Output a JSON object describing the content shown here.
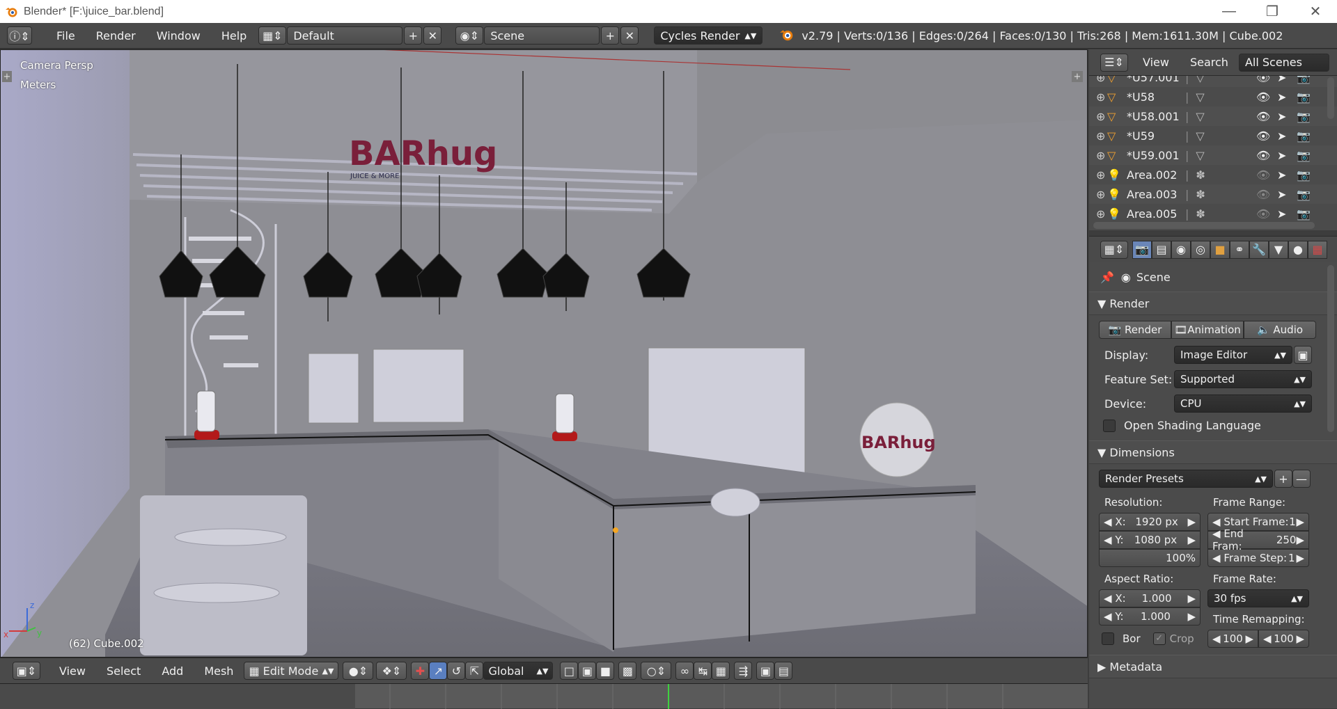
{
  "window": {
    "title": "Blender* [F:\\juice_bar.blend]",
    "app_icon": "blender-logo"
  },
  "infobar": {
    "menus": [
      "File",
      "Render",
      "Window",
      "Help"
    ],
    "screen_layout": "Default",
    "scene": "Scene",
    "render_engine": "Cycles Render",
    "stats": "v2.79 | Verts:0/136 | Edges:0/264 | Faces:0/130 | Tris:268 | Mem:1611.30M | Cube.002"
  },
  "viewport": {
    "view_name": "Camera Persp",
    "units": "Meters",
    "object_info": "(62) Cube.002",
    "axis_x": "x",
    "axis_y": "y",
    "axis_z": "z"
  },
  "view3d_header": {
    "menus": [
      "View",
      "Select",
      "Add",
      "Mesh"
    ],
    "mode": "Edit Mode",
    "orientation": "Global"
  },
  "outliner": {
    "menus": [
      "View",
      "Search"
    ],
    "filter": "All Scenes",
    "items": [
      {
        "name": "*U57.001",
        "type": "mesh"
      },
      {
        "name": "*U58",
        "type": "mesh"
      },
      {
        "name": "*U58.001",
        "type": "mesh"
      },
      {
        "name": "*U59",
        "type": "mesh"
      },
      {
        "name": "*U59.001",
        "type": "mesh"
      },
      {
        "name": "Area.002",
        "type": "lamp"
      },
      {
        "name": "Area.003",
        "type": "lamp"
      },
      {
        "name": "Area.005",
        "type": "lamp"
      }
    ]
  },
  "properties": {
    "context": "Scene",
    "render_panel": {
      "title": "Render",
      "buttons": [
        "Render",
        "Animation",
        "Audio"
      ],
      "display_label": "Display:",
      "display_value": "Image Editor",
      "feature_label": "Feature Set:",
      "feature_value": "Supported",
      "device_label": "Device:",
      "device_value": "CPU",
      "osl_label": "Open Shading Language"
    },
    "dimensions_panel": {
      "title": "Dimensions",
      "presets": "Render Presets",
      "resolution_label": "Resolution:",
      "res_x_label": "X:",
      "res_x": "1920 px",
      "res_y_label": "Y:",
      "res_y": "1080 px",
      "res_pct": "100%",
      "frame_range_label": "Frame Range:",
      "start_label": "Start Frame:",
      "start": "1",
      "end_label": "End Fram:",
      "end": "250",
      "step_label": "Frame Step:",
      "step": "1",
      "aspect_label": "Aspect Ratio:",
      "asp_x_label": "X:",
      "asp_x": "1.000",
      "asp_y_label": "Y:",
      "asp_y": "1.000",
      "frame_rate_label": "Frame Rate:",
      "frame_rate": "30 fps",
      "remap_label": "Time Remapping:",
      "remap_old": "100",
      "remap_new": "100",
      "border_label": "Bor",
      "crop_label": "Crop"
    },
    "metadata_panel": {
      "title": "Metadata"
    }
  },
  "scene_logo": {
    "text": "BARhug",
    "sub": "JUICE & MORE"
  }
}
